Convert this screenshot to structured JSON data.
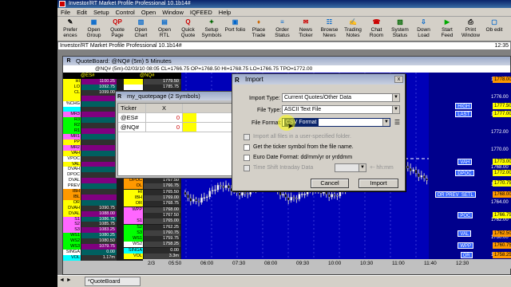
{
  "app": {
    "title": "Investor/RT Market Profile Professional 10.1b14#",
    "menu": [
      "File",
      "Edit",
      "Setup",
      "Control",
      "Open",
      "Window",
      "IQFEED",
      "Help"
    ],
    "toolbar": [
      {
        "label": "Prefer ences",
        "icon": "preferences-icon"
      },
      {
        "label": "Open Group",
        "icon": "open-group-icon"
      },
      {
        "label": "Quote Page",
        "icon": "quote-page-icon"
      },
      {
        "label": "Open Chart",
        "icon": "open-chart-icon"
      },
      {
        "label": "Open RTL",
        "icon": "open-rtl-icon"
      },
      {
        "label": "Quick Quote",
        "icon": "quick-quote-icon"
      },
      {
        "label": "Setup Symbols",
        "icon": "setup-symbols-icon"
      },
      {
        "label": "Port folio",
        "icon": "portfolio-icon"
      },
      {
        "label": "Place Trade",
        "icon": "place-trade-icon"
      },
      {
        "label": "Order Status",
        "icon": "order-status-icon"
      },
      {
        "label": "News Ticker",
        "icon": "news-ticker-icon"
      },
      {
        "label": "Browse News",
        "icon": "browse-news-icon"
      },
      {
        "label": "Trading Notes",
        "icon": "trading-notes-icon"
      },
      {
        "label": "Chat Room",
        "icon": "chat-room-icon"
      },
      {
        "label": "System Status",
        "icon": "system-status-icon"
      },
      {
        "label": "Down Load",
        "icon": "download-icon"
      },
      {
        "label": "Start Feed",
        "icon": "start-feed-icon"
      },
      {
        "label": "Print Window",
        "icon": "print-window-icon"
      },
      {
        "label": "Ob edit",
        "icon": "object-edit-icon"
      }
    ],
    "status_text": "Investor/RT Market Profile Professional 10.1b14#",
    "status_time": "12:35",
    "taskbar_tab": "*QuoteBoard"
  },
  "quoteboard": {
    "title": "QuoteBoard: @NQ# (5m) 5 Minutes",
    "info": "@NQ# (5m)-02/03/10 08:05 CL=1766.75 OP=1768.50 HI=1768.75 LO=1766.75 TPO=1772.00",
    "time_labels": [
      "05:50",
      "06:00",
      "07:30",
      "08:00",
      "09:30",
      "10:00",
      "10:30",
      "11:00",
      "11:40",
      "12:30"
    ],
    "page_label": "2/3",
    "right_prices": [
      "1778.00",
      "1776.00",
      "1774.00",
      "1772.00",
      "1770.00",
      "1768.00",
      "1766.00",
      "1764.00",
      "1762.00",
      "1760.00",
      "1758.00"
    ],
    "right_tags": [
      {
        "text": "1778.00",
        "label": "",
        "color": "#ff9900"
      },
      {
        "text": "1777.50",
        "label": "HIGH",
        "color": "#ffff00"
      },
      {
        "text": "1777.00",
        "label": "LAST",
        "color": "#ffff00"
      },
      {
        "text": "1773.00",
        "label": "VAH",
        "color": "#ffff00"
      },
      {
        "text": "1772.00",
        "label": "DPOC",
        "color": "#ffff00"
      },
      {
        "text": "1770.75",
        "label": "",
        "color": "#ffff00"
      },
      {
        "text": "1768.00",
        "label": "OR PREV_SETL",
        "color": "#ff9900"
      },
      {
        "text": "1766.75",
        "label": "POC",
        "color": "#ffff00"
      },
      {
        "text": "1762.50",
        "label": "VAL",
        "color": "#ff9900"
      },
      {
        "text": "1760.75",
        "label": "WPP",
        "color": "#ff9900"
      },
      {
        "text": "1758.25",
        "label": "OR",
        "color": "#ff9900"
      }
    ],
    "left_col1_label": "@ES#",
    "left_col2_label": "@NQ#",
    "left_rows1": [
      [
        "HI",
        "1100.25"
      ],
      [
        "LO",
        "1092.75"
      ],
      [
        "CL",
        "1099.00"
      ],
      [
        "",
        ""
      ],
      [
        "%CHG",
        ""
      ],
      [
        "",
        ""
      ],
      [
        "MR3",
        ""
      ],
      [
        "R3",
        ""
      ],
      [
        "R2",
        ""
      ],
      [
        "R1",
        ""
      ],
      [
        "MR1",
        ""
      ],
      [
        "PP",
        ""
      ],
      [
        "MR2",
        ""
      ],
      [
        "VAH",
        ""
      ],
      [
        "VPOC",
        ""
      ],
      [
        "VAL",
        ""
      ],
      [
        "DVAH",
        ""
      ],
      [
        "DPOC",
        ""
      ],
      [
        "DVAL",
        ""
      ],
      [
        "PREV",
        ""
      ],
      [
        "IBH",
        ""
      ],
      [
        "IBL",
        ""
      ],
      [
        "OR",
        ""
      ],
      [
        "DVAH",
        "1090.75"
      ],
      [
        "DVAL",
        "1088.00"
      ],
      [
        "S1",
        "1086.75"
      ],
      [
        "S2",
        "1085.75"
      ],
      [
        "S3",
        "1083.25"
      ],
      [
        "WS1",
        "1080.25"
      ],
      [
        "WS2",
        "1080.50"
      ],
      [
        "WS3",
        "1079.75"
      ],
      [
        "SINGA",
        "0.00"
      ],
      [
        "VOL",
        "1.17m"
      ]
    ],
    "left_rows2": [
      [
        "",
        "1779.50"
      ],
      [
        "",
        "1785.75"
      ],
      [
        "",
        "1774.50"
      ],
      [
        "",
        "1777.00"
      ],
      [
        "",
        ""
      ],
      [
        "",
        ""
      ],
      [
        "",
        ""
      ],
      [
        "",
        ""
      ],
      [
        "",
        ""
      ],
      [
        "",
        ""
      ],
      [
        "",
        ""
      ],
      [
        "",
        ""
      ],
      [
        "",
        ""
      ],
      [
        "",
        ""
      ],
      [
        "",
        ""
      ],
      [
        "OP",
        "1769.00"
      ],
      [
        "PREV",
        "1768.00"
      ],
      [
        "DPOC",
        "1767.50"
      ],
      [
        "OL",
        "1766.75"
      ],
      [
        "HI",
        "1765.50"
      ],
      [
        "IBH",
        "1769.00"
      ],
      [
        "OR",
        "1768.75"
      ],
      [
        "WPP",
        "1768.00"
      ],
      [
        "",
        "1767.50"
      ],
      [
        "S1",
        "1765.00"
      ],
      [
        "S2",
        "1762.25"
      ],
      [
        "S3",
        "1760.75"
      ],
      [
        "WS1",
        "1759.75"
      ],
      [
        "WS2",
        "1758.25"
      ],
      [
        "SINGA",
        "0.00"
      ],
      [
        "VOL",
        "3.3m"
      ]
    ]
  },
  "quotepage": {
    "title": "my_quotepage (2 Symbols)",
    "col_ticker": "Ticker",
    "col_x": "X",
    "rows": [
      {
        "ticker": "@ES#",
        "value": "0"
      },
      {
        "ticker": "@NQ#",
        "value": "0"
      }
    ]
  },
  "dialog": {
    "title": "Import",
    "import_type_label": "Import Type:",
    "import_type_value": "Current Quotes/Other Data",
    "file_type_label": "File Type:",
    "file_type_value": "ASCII Text File",
    "file_format_label": "File Format:",
    "file_format_value": "CSV Format",
    "opt_all_files": "Import all files in a user-specified folder.",
    "opt_ticker": "Get the ticker symbol from the file name.",
    "opt_euro": "Euro Date Format: dd/mm/yr or yrddmm",
    "opt_timeshift": "Time Shift Intraday Data",
    "timeshift_suffix": "+- hh:mm",
    "cancel_label": "Cancel",
    "import_label": "Import"
  },
  "colors": {
    "chart_bg": "#0000b8",
    "axis_bg": "#00008c",
    "tag_yellow": "#ffff00",
    "tag_orange": "#ff9900",
    "highlight": "#ffff00",
    "selection": "#0a246a"
  }
}
